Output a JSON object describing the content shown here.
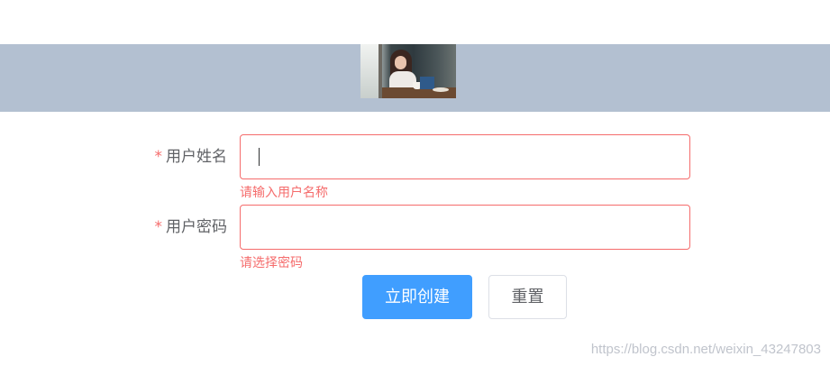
{
  "header": {
    "photo_alt": "girl-at-cafe-photo"
  },
  "form": {
    "username": {
      "required_mark": "*",
      "label": "用户姓名",
      "value": "",
      "error": "请输入用户名称"
    },
    "password": {
      "required_mark": "*",
      "label": "用户密码",
      "value": "",
      "error": "请选择密码"
    }
  },
  "actions": {
    "create_label": "立即创建",
    "reset_label": "重置"
  },
  "watermark": "https://blog.csdn.net/weixin_43247803",
  "colors": {
    "banner": "#b3c0d1",
    "primary": "#409eff",
    "error": "#f56c6c",
    "label": "#606266"
  }
}
